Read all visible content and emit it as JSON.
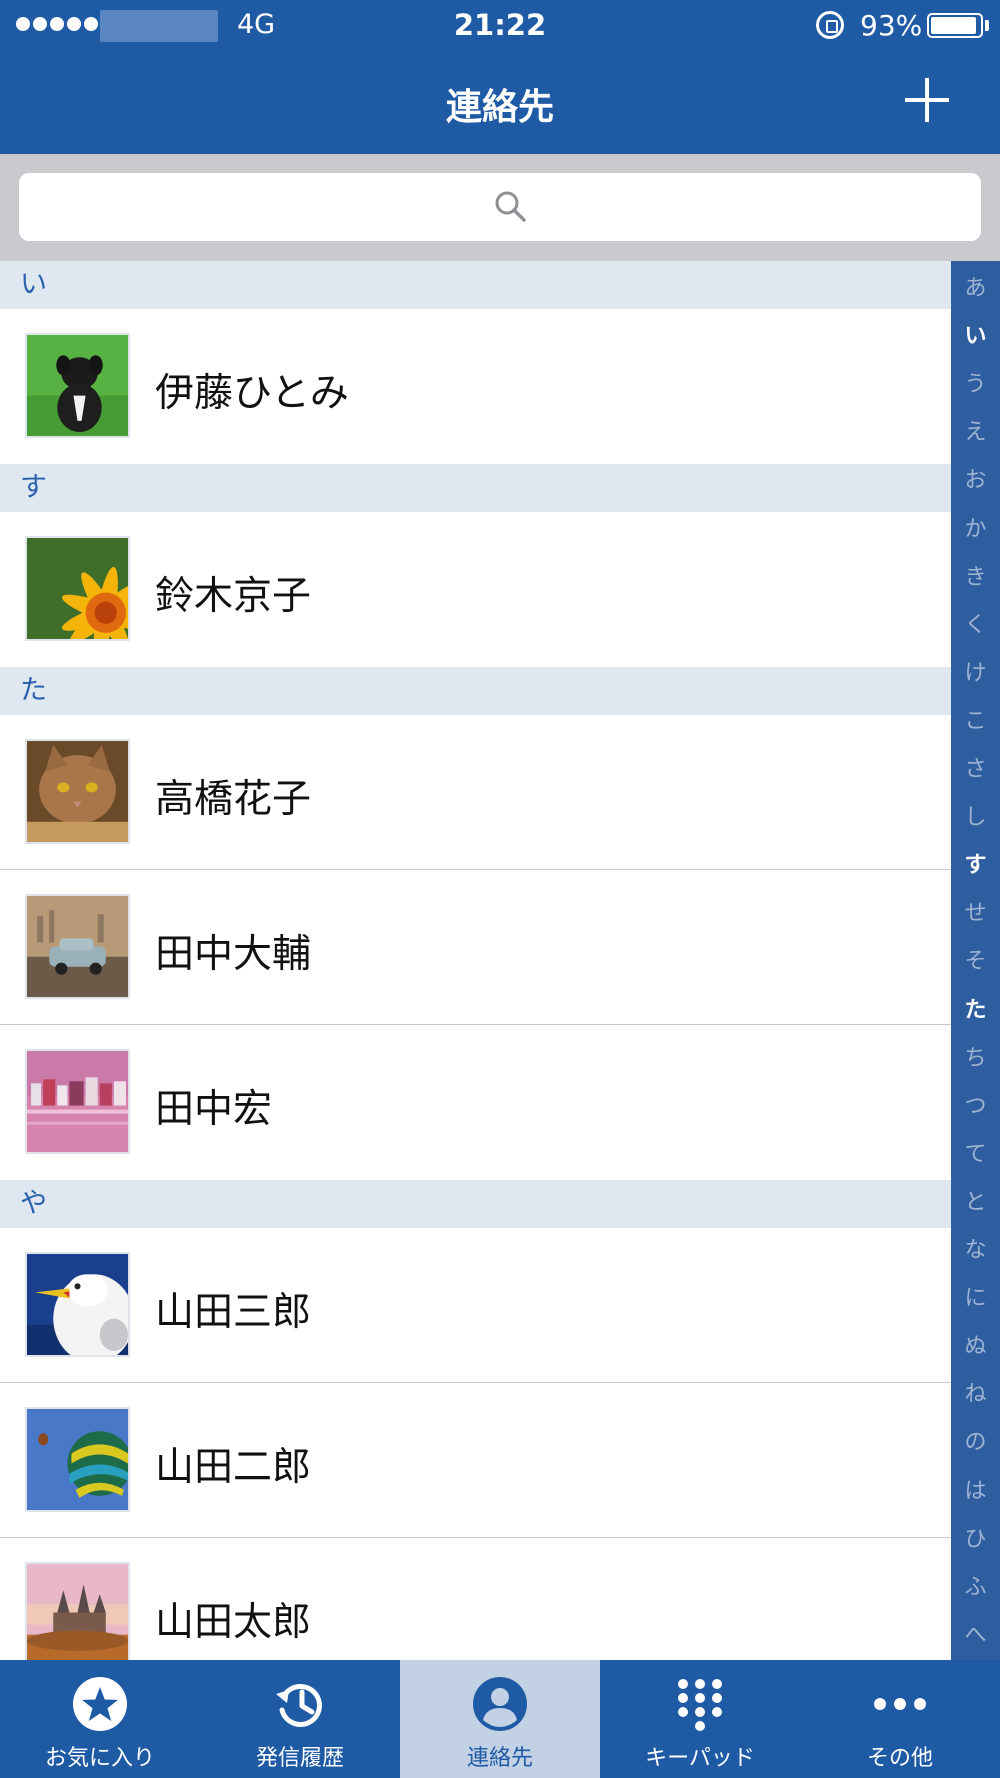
{
  "status_bar": {
    "network": "4G",
    "time": "21:22",
    "battery": "93%",
    "battery_level": 0.93,
    "icons": [
      "signal-icon",
      "orientation-lock-icon",
      "battery-icon"
    ]
  },
  "nav": {
    "title": "連絡先",
    "add_icon": "plus-icon"
  },
  "search": {
    "icon": "search-icon",
    "placeholder": ""
  },
  "contacts": {
    "sections": [
      {
        "header": "い",
        "rows": [
          {
            "name": "伊藤ひとみ",
            "avatar": "puppy-photo"
          }
        ]
      },
      {
        "header": "す",
        "rows": [
          {
            "name": "鈴木京子",
            "avatar": "sunflower-photo"
          }
        ]
      },
      {
        "header": "た",
        "rows": [
          {
            "name": "高橋花子",
            "avatar": "cat-photo"
          },
          {
            "name": "田中大輔",
            "avatar": "car-photo"
          },
          {
            "name": "田中宏",
            "avatar": "harbor-photo"
          }
        ]
      },
      {
        "header": "や",
        "rows": [
          {
            "name": "山田三郎",
            "avatar": "seagull-photo"
          },
          {
            "name": "山田二郎",
            "avatar": "balloon-photo"
          },
          {
            "name": "山田太郎",
            "avatar": "castle-photo"
          }
        ]
      }
    ]
  },
  "index": [
    "あ",
    "い",
    "う",
    "え",
    "お",
    "か",
    "き",
    "く",
    "け",
    "こ",
    "さ",
    "し",
    "す",
    "せ",
    "そ",
    "た",
    "ち",
    "つ",
    "て",
    "と",
    "な",
    "に",
    "ぬ",
    "ね",
    "の",
    "は",
    "ひ",
    "ふ",
    "へ"
  ],
  "index_active": [
    "い",
    "す",
    "た"
  ],
  "tabs": [
    {
      "label": "お気に入り",
      "icon": "star-icon",
      "selected": false
    },
    {
      "label": "発信履歴",
      "icon": "history-icon",
      "selected": false
    },
    {
      "label": "連絡先",
      "icon": "person-icon",
      "selected": true
    },
    {
      "label": "キーパッド",
      "icon": "keypad-icon",
      "selected": false
    },
    {
      "label": "その他",
      "icon": "more-icon",
      "selected": false
    }
  ],
  "colors": {
    "brand_blue": "#1f5aa5",
    "section_header_bg": "#dfe7f1",
    "section_header_text": "#2a62ad",
    "index_bg": "#2f5ea0",
    "selected_tab_bg": "#c3d1e5"
  }
}
